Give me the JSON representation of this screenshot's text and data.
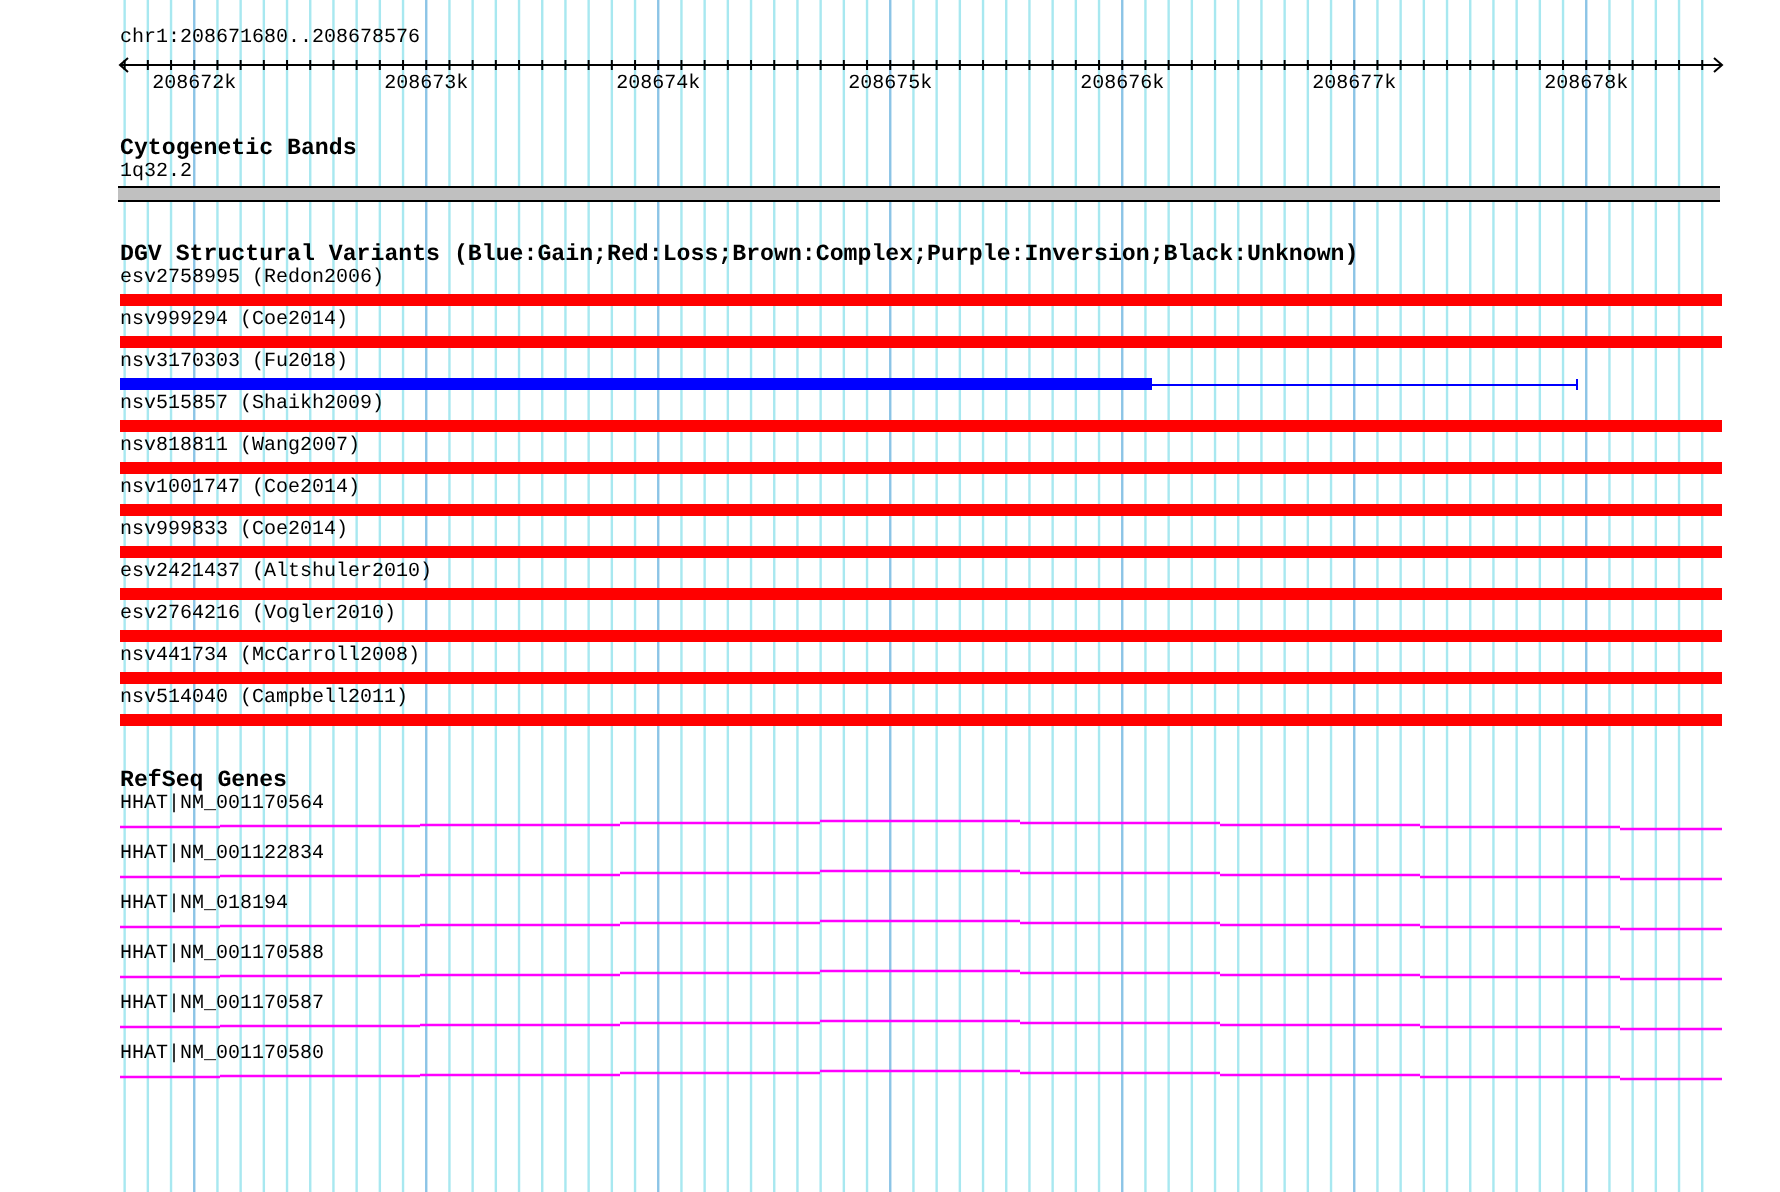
{
  "ruler": {
    "label": "chr1:208671680..208678576",
    "ticks": [
      "208672k",
      "208673k",
      "208674k",
      "208675k",
      "208676k",
      "208677k",
      "208678k"
    ]
  },
  "tracks": [
    {
      "kind": "cytoband",
      "title": "Cytogenetic Bands",
      "features": [
        {
          "label": "1q32.2"
        }
      ]
    },
    {
      "kind": "variants",
      "title": "DGV Structural Variants (Blue:Gain;Red:Loss;Brown:Complex;Purple:Inversion;Black:Unknown)",
      "features": [
        {
          "label": "esv2758995 (Redon2006)",
          "color": "#ff0000",
          "kind": "full"
        },
        {
          "label": "nsv999294 (Coe2014)",
          "color": "#ff0000",
          "kind": "full"
        },
        {
          "label": "nsv3170303 (Fu2018)",
          "color": "#0000ff",
          "kind": "partial"
        },
        {
          "label": "nsv515857 (Shaikh2009)",
          "color": "#ff0000",
          "kind": "full"
        },
        {
          "label": "nsv818811 (Wang2007)",
          "color": "#ff0000",
          "kind": "full"
        },
        {
          "label": "nsv1001747 (Coe2014)",
          "color": "#ff0000",
          "kind": "full"
        },
        {
          "label": "nsv999833 (Coe2014)",
          "color": "#ff0000",
          "kind": "full"
        },
        {
          "label": "esv2421437 (Altshuler2010)",
          "color": "#ff0000",
          "kind": "full"
        },
        {
          "label": "esv2764216 (Vogler2010)",
          "color": "#ff0000",
          "kind": "full"
        },
        {
          "label": "nsv441734 (McCarroll2008)",
          "color": "#ff0000",
          "kind": "full"
        },
        {
          "label": "nsv514040 (Campbell2011)",
          "color": "#ff0000",
          "kind": "full"
        }
      ]
    },
    {
      "kind": "genes",
      "title": "RefSeq Genes",
      "features": [
        {
          "label": "HHAT|NM_001170564"
        },
        {
          "label": "HHAT|NM_001122834"
        },
        {
          "label": "HHAT|NM_018194"
        },
        {
          "label": "HHAT|NM_001170588"
        },
        {
          "label": "HHAT|NM_001170587"
        },
        {
          "label": "HHAT|NM_001170580"
        }
      ]
    }
  ]
}
